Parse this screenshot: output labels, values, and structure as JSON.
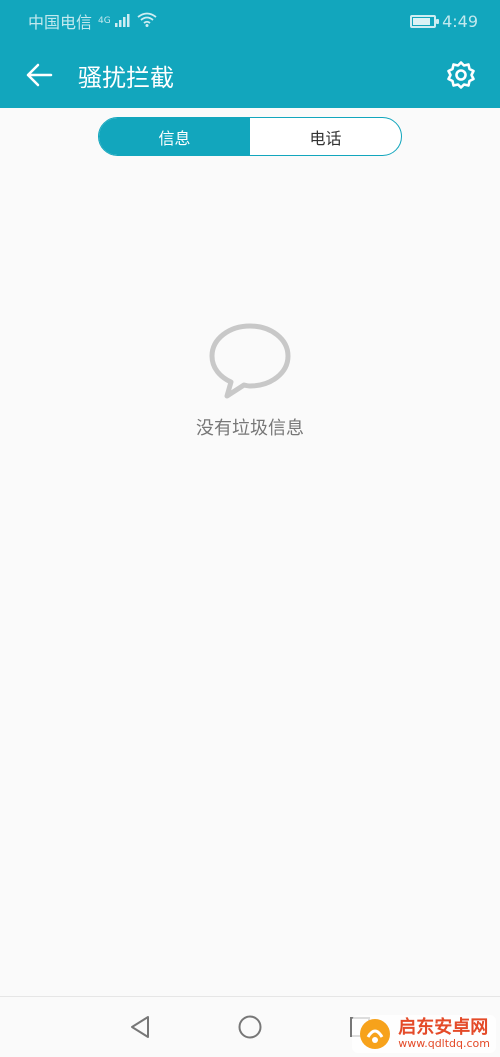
{
  "status_bar": {
    "carrier": "中国电信",
    "network_type": "4G",
    "time": "4:49",
    "battery_percent": 85
  },
  "app_bar": {
    "title": "骚扰拦截",
    "back_icon": "arrow-left-icon",
    "settings_icon": "gear-icon"
  },
  "tabs": [
    {
      "label": "信息",
      "active": true
    },
    {
      "label": "电话",
      "active": false
    }
  ],
  "empty_state": {
    "icon": "speech-bubble-icon",
    "message": "没有垃圾信息"
  },
  "nav_bar": {
    "back_icon": "triangle-back-icon",
    "home_icon": "circle-home-icon",
    "recents_icon": "square-recents-icon"
  },
  "watermark": {
    "title": "启东安卓网",
    "url": "www.qdltdq.com"
  },
  "colors": {
    "primary": "#12a6bd",
    "background": "#fafafa",
    "empty_text": "#777777",
    "empty_icon": "#c8c8c8"
  }
}
